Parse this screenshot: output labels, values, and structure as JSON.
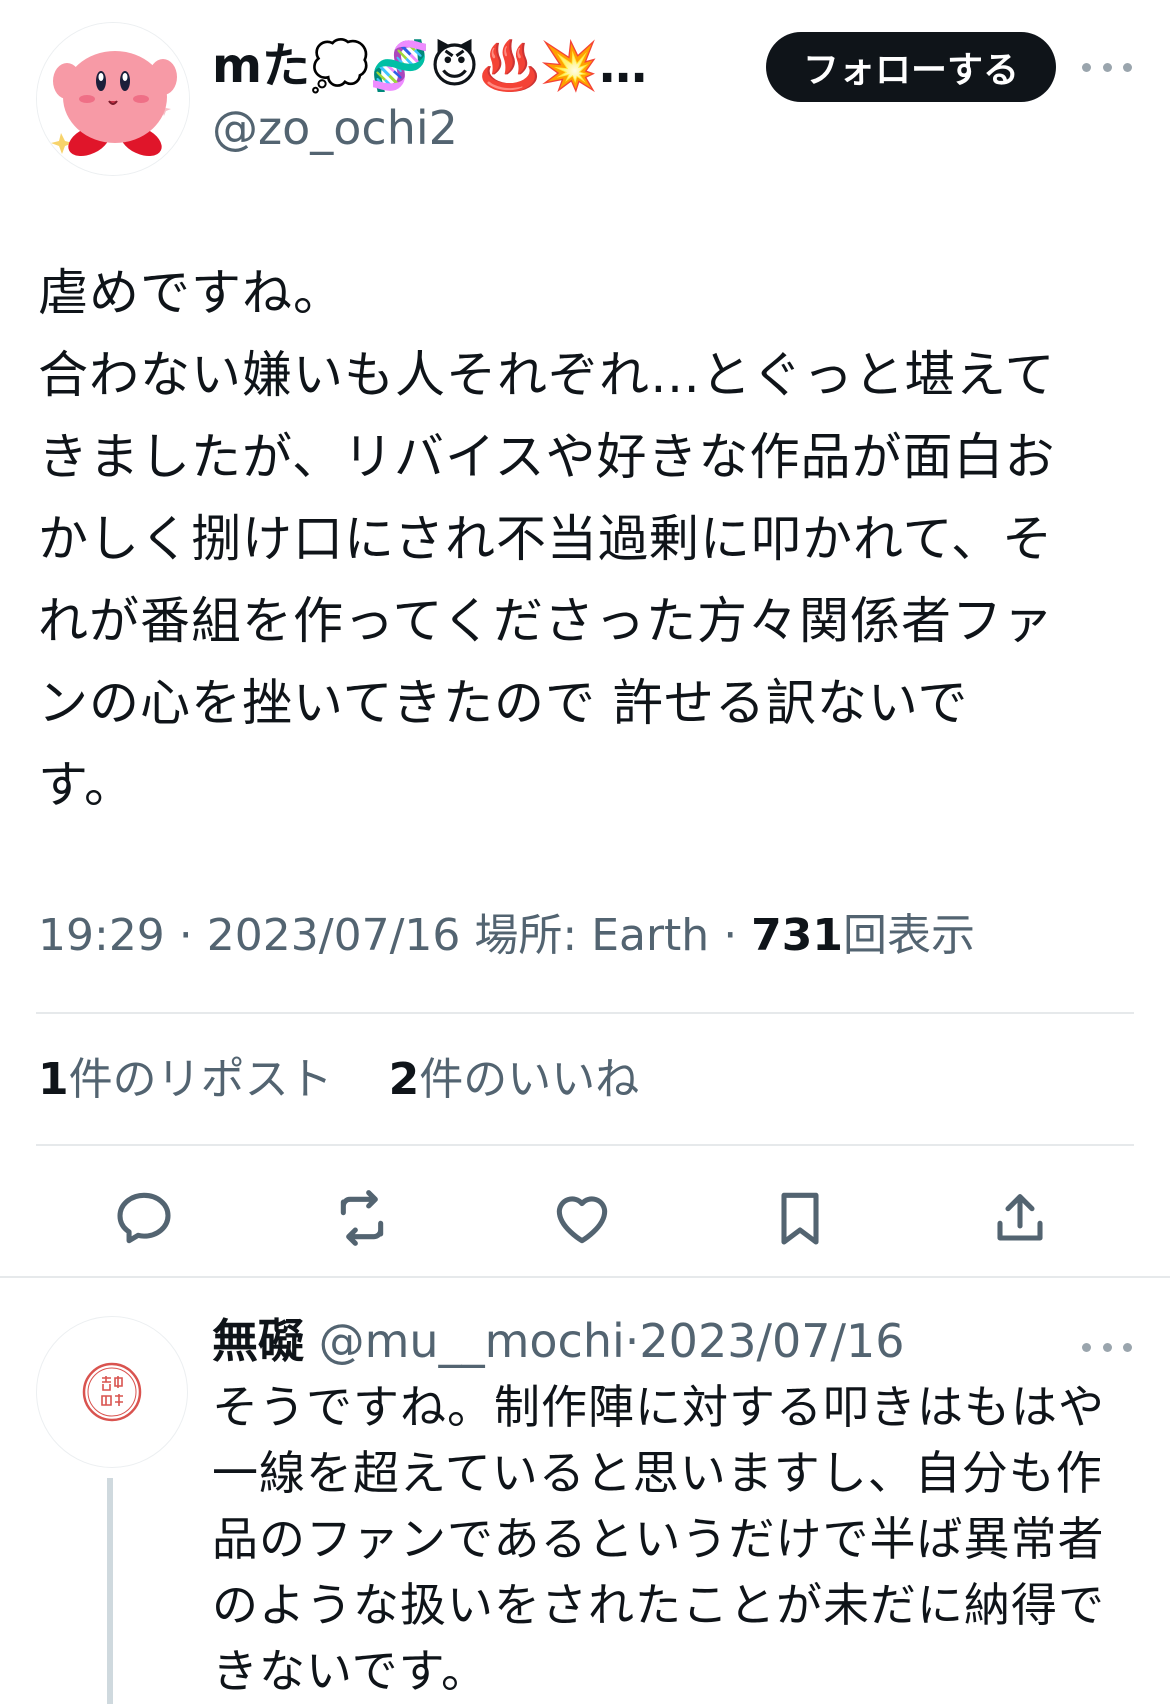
{
  "tweet": {
    "display_name": "mた💭🧬😈♨️💥…",
    "handle": "@zo_ochi2",
    "follow_label": "フォローする",
    "text": "虐めですね。\n合わない嫌いも人それぞれ…とぐっと堪えて\nきましたが、リバイスや好きな作品が面白お\nかしく捌け口にされ不当過剰に叩かれて、そ\nれが番組を作ってくださった方々関係者ファ\nンの心を挫いてきたので 許せる訳ないで\nす。",
    "time": "19:29",
    "date": "2023/07/16",
    "location": "場所: Earth",
    "views_count": "731",
    "views_label": "回表示",
    "reposts_count": "1",
    "reposts_label": "件のリポスト",
    "likes_count": "2",
    "likes_label": "件のいいね"
  },
  "actions": [
    "reply-icon",
    "repost-icon",
    "like-icon",
    "bookmark-icon",
    "share-icon"
  ],
  "reply": {
    "display_name": "無礙",
    "handle": "@mu__mochi",
    "separator": "·",
    "date": "2023/07/16",
    "avatar_text": "融通無礙",
    "text": "そうですね。制作陣に対する叩きはもはや\n一線を超えていると思いますし、自分も作\n品のファンであるというだけで半ば異常者\nのような扱いをされたことが未だに納得で\nきないです。"
  },
  "colors": {
    "text": "#0f1419",
    "secondary": "#536471",
    "divider": "#e6e9eb",
    "button_bg": "#0f1419",
    "avatar_pink": "#f59aa8",
    "seal_red": "#d9534f"
  }
}
